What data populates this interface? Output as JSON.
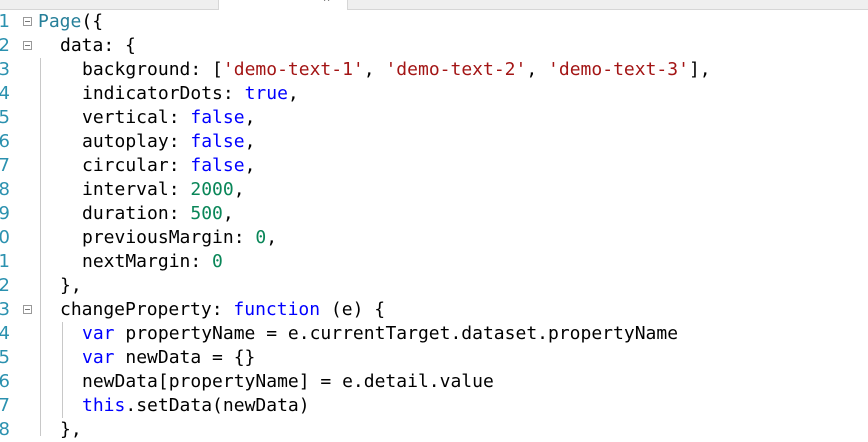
{
  "editor": {
    "lines": [
      {
        "n": "1",
        "fold": true,
        "indent": 0,
        "tokens": [
          [
            "fn",
            "Page"
          ],
          [
            "id",
            "({"
          ]
        ]
      },
      {
        "n": "2",
        "fold": true,
        "indent": 1,
        "tokens": [
          [
            "id",
            "data: {"
          ]
        ]
      },
      {
        "n": "3",
        "indent": 2,
        "tokens": [
          [
            "id",
            "background: ["
          ],
          [
            "str",
            "'demo-text-1'"
          ],
          [
            "id",
            ", "
          ],
          [
            "str",
            "'demo-text-2'"
          ],
          [
            "id",
            ", "
          ],
          [
            "str",
            "'demo-text-3'"
          ],
          [
            "id",
            "],"
          ]
        ]
      },
      {
        "n": "4",
        "indent": 2,
        "tokens": [
          [
            "id",
            "indicatorDots: "
          ],
          [
            "kw",
            "true"
          ],
          [
            "id",
            ","
          ]
        ]
      },
      {
        "n": "5",
        "indent": 2,
        "tokens": [
          [
            "id",
            "vertical: "
          ],
          [
            "kw",
            "false"
          ],
          [
            "id",
            ","
          ]
        ]
      },
      {
        "n": "6",
        "indent": 2,
        "tokens": [
          [
            "id",
            "autoplay: "
          ],
          [
            "kw",
            "false"
          ],
          [
            "id",
            ","
          ]
        ]
      },
      {
        "n": "7",
        "indent": 2,
        "tokens": [
          [
            "id",
            "circular: "
          ],
          [
            "kw",
            "false"
          ],
          [
            "id",
            ","
          ]
        ]
      },
      {
        "n": "8",
        "indent": 2,
        "tokens": [
          [
            "id",
            "interval: "
          ],
          [
            "num",
            "2000"
          ],
          [
            "id",
            ","
          ]
        ]
      },
      {
        "n": "9",
        "indent": 2,
        "tokens": [
          [
            "id",
            "duration: "
          ],
          [
            "num",
            "500"
          ],
          [
            "id",
            ","
          ]
        ]
      },
      {
        "n": "0",
        "indent": 2,
        "tokens": [
          [
            "id",
            "previousMargin: "
          ],
          [
            "num",
            "0"
          ],
          [
            "id",
            ","
          ]
        ]
      },
      {
        "n": "1",
        "indent": 2,
        "tokens": [
          [
            "id",
            "nextMargin: "
          ],
          [
            "num",
            "0"
          ]
        ]
      },
      {
        "n": "2",
        "indent": 1,
        "tokens": [
          [
            "id",
            "},"
          ]
        ]
      },
      {
        "n": "3",
        "fold": true,
        "indent": 1,
        "tokens": [
          [
            "id",
            "changeProperty: "
          ],
          [
            "kw",
            "function"
          ],
          [
            "id",
            " (e) {"
          ]
        ]
      },
      {
        "n": "4",
        "indent": 2,
        "tokens": [
          [
            "kw",
            "var"
          ],
          [
            "id",
            " propertyName = e.currentTarget.dataset.propertyName"
          ]
        ]
      },
      {
        "n": "5",
        "indent": 2,
        "tokens": [
          [
            "kw",
            "var"
          ],
          [
            "id",
            " newData = {}"
          ]
        ]
      },
      {
        "n": "6",
        "indent": 2,
        "tokens": [
          [
            "id",
            "newData[propertyName] = e.detail.value"
          ]
        ]
      },
      {
        "n": "7",
        "indent": 2,
        "tokens": [
          [
            "kw",
            "this"
          ],
          [
            "id",
            ".setData(newData)"
          ]
        ]
      },
      {
        "n": "8",
        "indent": 1,
        "tokens": [
          [
            "id",
            "},"
          ]
        ]
      }
    ]
  },
  "tabs": {
    "close_icon": "×"
  }
}
